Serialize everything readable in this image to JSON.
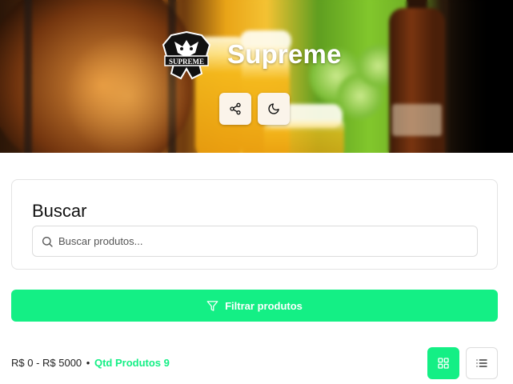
{
  "store": {
    "name": "Supreme",
    "logo_text": "SUPREME"
  },
  "hero": {
    "share_icon": "share-icon",
    "theme_icon": "moon-icon"
  },
  "search": {
    "title": "Buscar",
    "placeholder": "Buscar produtos...",
    "value": "",
    "icon": "search-icon"
  },
  "filter": {
    "label": "Filtrar produtos",
    "icon": "filter-icon"
  },
  "summary": {
    "price_range": "R$ 0 - R$ 5000",
    "separator": "•",
    "quantity": "Qtd Produtos 9"
  },
  "view": {
    "grid_icon": "grid-icon",
    "list_icon": "list-icon",
    "active": "grid"
  },
  "colors": {
    "accent": "#14ef85",
    "hero_button_bg": "#fbf4ea",
    "card_border": "#e3e3e3"
  }
}
